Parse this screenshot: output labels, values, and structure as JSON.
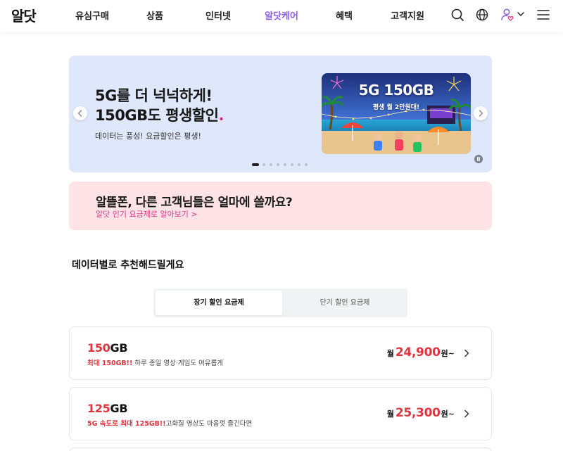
{
  "header": {
    "logo": "알닷",
    "nav": [
      {
        "label": "유심구매",
        "active": false
      },
      {
        "label": "상품",
        "active": false
      },
      {
        "label": "인터넷",
        "active": false
      },
      {
        "label": "알닷케어",
        "active": true
      },
      {
        "label": "혜택",
        "active": false
      },
      {
        "label": "고객지원",
        "active": false
      }
    ],
    "icons": [
      "search-icon",
      "globe-icon",
      "user-heart-icon",
      "chevron-down-icon",
      "hamburger-menu-icon"
    ]
  },
  "banner": {
    "title_line1": "5G를 더 넉넉하게!",
    "title_line2": "150GB도 평생할인",
    "title_dot": ".",
    "subtitle": "데이터는 풍성! 요금할인은 평생!",
    "image_title": "5G 150GB",
    "image_subtitle": "평생 월 2만원대!",
    "slide_count": 8,
    "active_slide": 1
  },
  "promo": {
    "title": "알뜰폰, 다른 고객님들은 얼마에 쓸까요?",
    "link": "알닷 인기 요금제로 알아보기 >"
  },
  "section": {
    "title": "데이터별로 추천해드릴게요",
    "tabs": [
      {
        "label": "장기 할인 요금제",
        "active": true
      },
      {
        "label": "단기 할인 요금제",
        "active": false
      }
    ]
  },
  "plans": [
    {
      "data_num": "150",
      "data_unit": "GB",
      "desc_hl": "최대 150GB!!",
      "desc": " 하루 종일 영상·게임도 여유롭게",
      "price_prefix": "월",
      "price": "24,900",
      "price_suffix": "원~"
    },
    {
      "data_num": "125",
      "data_unit": "GB",
      "desc_hl": "5G 속도로 최대 125GB!!",
      "desc": "고화질 영상도 마음껏 즐긴다면",
      "price_prefix": "월",
      "price": "25,300",
      "price_suffix": "원~"
    }
  ],
  "colors": {
    "accent_purple": "#8b5cf6",
    "price_red": "#e0343f",
    "promo_pink": "#e5338a",
    "banner_bg": "#dfe7fb",
    "promo_bg": "#fde3e5"
  }
}
